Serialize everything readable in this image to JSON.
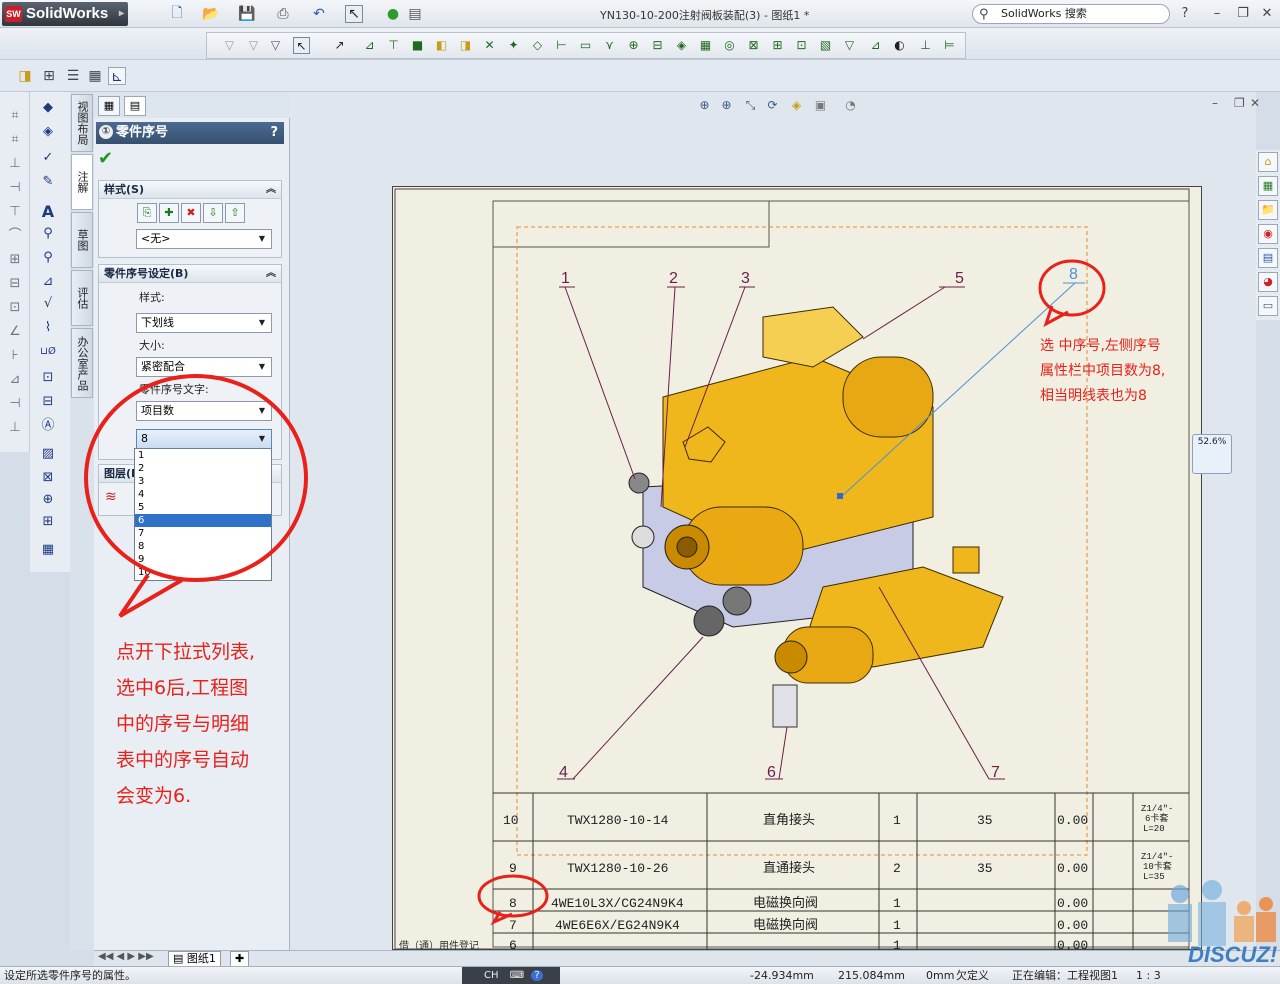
{
  "app": {
    "logo": "SolidWorks",
    "document_title": "YN130-10-200注射阀板装配(3) - 图纸1 *",
    "search_placeholder": "SolidWorks 搜索"
  },
  "vertical_tabs": [
    "视图布局",
    "注解",
    "草图",
    "评估",
    "办公室产品"
  ],
  "property_manager": {
    "title": "零件序号",
    "help": "?",
    "style_group": {
      "title": "样式(S)",
      "style_value": "<无>"
    },
    "balloon_settings": {
      "title": "零件序号设定(B)",
      "style_label": "样式:",
      "style_value": "下划线",
      "size_label": "大小:",
      "size_value": "紧密配合",
      "text_label": "零件序号文字:",
      "text_value": "项目数",
      "number_value": "8"
    },
    "layer_group_title": "图层(L)",
    "dropdown_options": [
      "1",
      "2",
      "3",
      "4",
      "5",
      "6",
      "7",
      "8",
      "9",
      "10"
    ],
    "dropdown_selected": "6"
  },
  "drawing": {
    "balloons": [
      "1",
      "2",
      "3",
      "4",
      "5",
      "6",
      "7",
      "8"
    ],
    "bom_rows": [
      {
        "no": "10",
        "code": "TWX1280-10-14",
        "name": "直角接头",
        "qty": "1",
        "mat": "35",
        "weight": "0.00",
        "note1": "Z1/4\"-",
        "note2": "6卡套",
        "note3": "L=20"
      },
      {
        "no": "9",
        "code": "TWX1280-10-26",
        "name": "直通接头",
        "qty": "2",
        "mat": "35",
        "weight": "0.00",
        "note1": "Z1/4\"-",
        "note2": "10卡套",
        "note3": "L=35"
      },
      {
        "no": "8",
        "code": "4WE10L3X/CG24N9K4",
        "name": "电磁换向阀",
        "qty": "1",
        "mat": "",
        "weight": "0.00",
        "note1": "",
        "note2": "",
        "note3": ""
      },
      {
        "no": "7",
        "code": "4WE6E6X/EG24N9K4",
        "name": "电磁换向阀",
        "qty": "1",
        "mat": "",
        "weight": "0.00",
        "note1": "",
        "note2": "",
        "note3": ""
      },
      {
        "no": "6",
        "code": "",
        "name": "",
        "qty": "1",
        "mat": "",
        "weight": "0.00",
        "note1": "",
        "note2": "",
        "note3": ""
      }
    ],
    "partial_text": "借（通）用件登记"
  },
  "annotations": {
    "left_lines": [
      "点开下拉式列表,",
      "选中6后,工程图",
      "中的序号与明细",
      "表中的序号自动",
      "会变为6."
    ],
    "right_lines": [
      "选 中序号,左侧序号",
      "属性栏中项目数为8,",
      "相当明线表也为8"
    ]
  },
  "zoom": "52.6%",
  "sheet_tab": "图纸1",
  "status": {
    "message": "设定所选零件序号的属性。",
    "ime": "CH",
    "x": "-24.934mm",
    "y": "215.084mm",
    "z": "0mm",
    "state": "欠定义",
    "editing": "正在编辑：工程视图1",
    "scale": "1 : 3"
  },
  "watermark": "DISCUZ!",
  "colors": {
    "annotation_red": "#e8211b",
    "balloon_line": "#6a1f4a",
    "selected_balloon": "#4a90d9",
    "part_yellow": "#f0b71c",
    "sheet_bg": "#f0efe2"
  }
}
